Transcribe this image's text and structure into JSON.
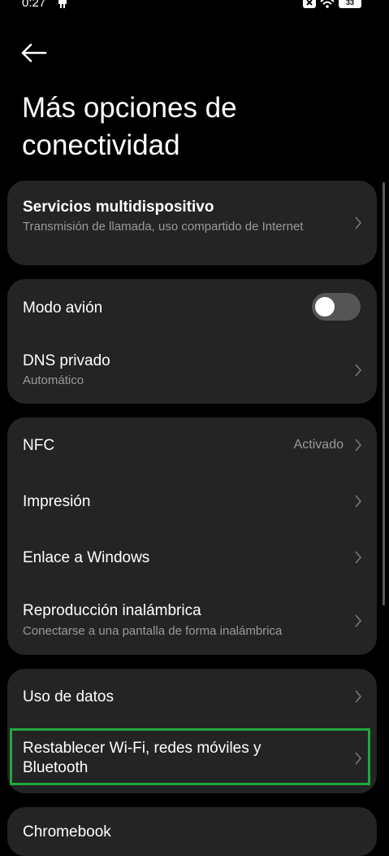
{
  "status_bar": {
    "time": "0:27",
    "battery": "33"
  },
  "header": {
    "title": "Más opciones de conectividad"
  },
  "cards": {
    "multidevice": {
      "title": "Servicios multidispositivo",
      "subtitle": "Transmisión de llamada, uso compartido de Internet"
    },
    "airplane": {
      "title": "Modo avión",
      "toggle_on": false
    },
    "dns": {
      "title": "DNS privado",
      "subtitle": "Automático"
    },
    "nfc": {
      "title": "NFC",
      "value": "Activado"
    },
    "printing": {
      "title": "Impresión"
    },
    "windows_link": {
      "title": "Enlace a Windows"
    },
    "wireless_display": {
      "title": "Reproducción inalámbrica",
      "subtitle": "Conectarse a una pantalla de forma inalámbrica"
    },
    "data_usage": {
      "title": "Uso de datos"
    },
    "reset_network": {
      "title": "Restablecer Wi-Fi, redes móviles y Bluetooth"
    },
    "chromebook": {
      "title": "Chromebook"
    }
  },
  "colors": {
    "background": "#000000",
    "card": "#242424",
    "subtitle": "#9a9a9a",
    "highlight": "#1fa83a"
  }
}
